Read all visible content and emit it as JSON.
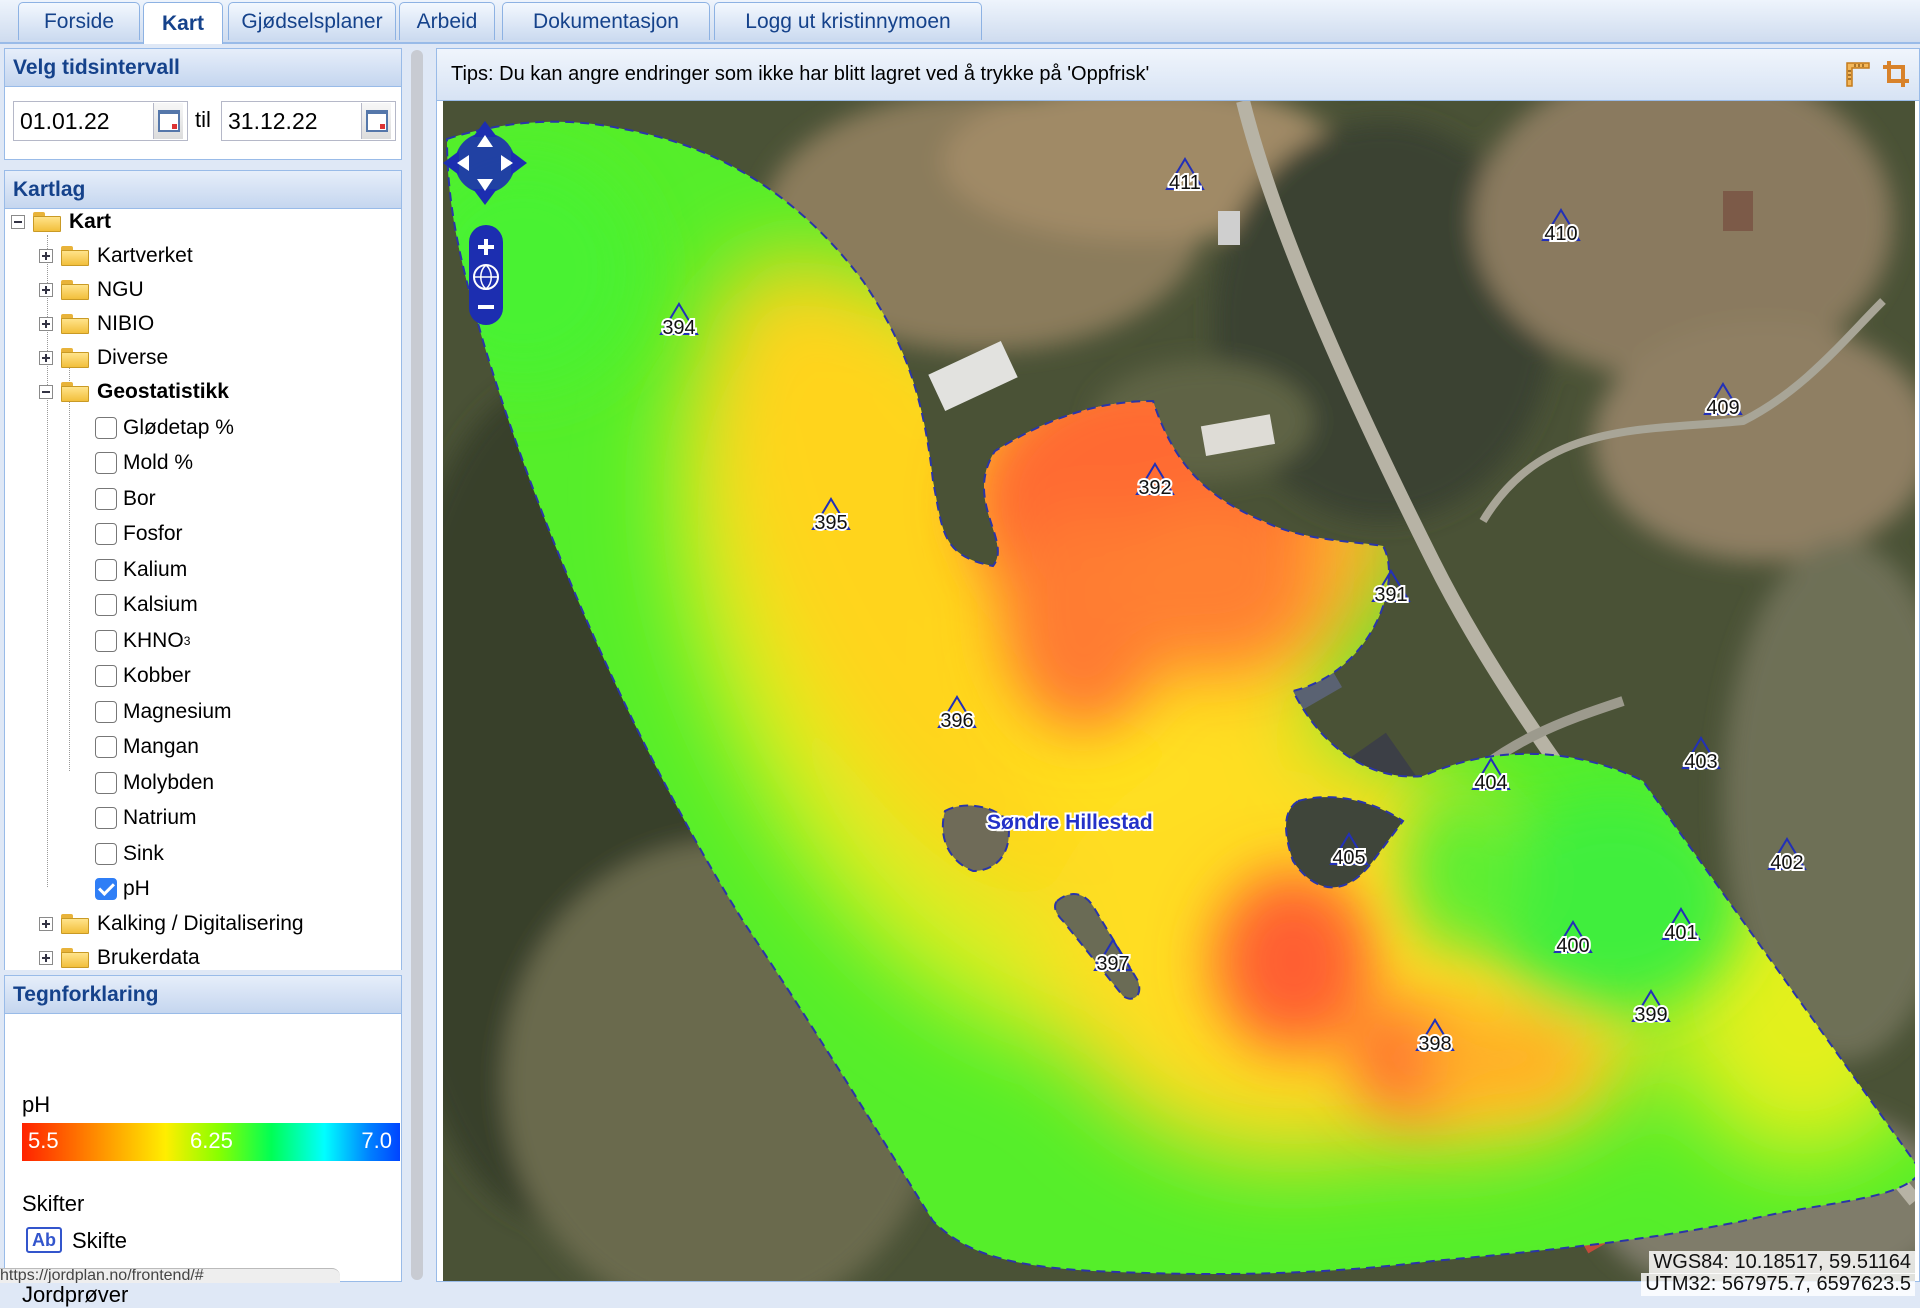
{
  "tabs": [
    {
      "label": "Forside",
      "active": false
    },
    {
      "label": "Kart",
      "active": true
    },
    {
      "label": "Gjødselsplaner",
      "active": false
    },
    {
      "label": "Arbeid",
      "active": false
    },
    {
      "label": "Dokumentasjon",
      "active": false
    },
    {
      "label": "Logg ut kristinnymoen",
      "active": false
    }
  ],
  "time_panel": {
    "title": "Velg tidsintervall",
    "from": "01.01.22",
    "to_label": "til",
    "to": "31.12.22"
  },
  "layers_panel": {
    "title": "Kartlag",
    "root": "Kart",
    "folders": [
      "Kartverket",
      "NGU",
      "NIBIO",
      "Diverse"
    ],
    "geostat_folder": "Geostatistikk",
    "geostat_items": [
      {
        "label": "Glødetap %",
        "checked": false
      },
      {
        "label": "Mold %",
        "checked": false
      },
      {
        "label": "Bor",
        "checked": false
      },
      {
        "label": "Fosfor",
        "checked": false
      },
      {
        "label": "Kalium",
        "checked": false
      },
      {
        "label": "Kalsium",
        "checked": false
      },
      {
        "label": "KHNO",
        "sub": "3",
        "checked": false
      },
      {
        "label": "Kobber",
        "checked": false
      },
      {
        "label": "Magnesium",
        "checked": false
      },
      {
        "label": "Mangan",
        "checked": false
      },
      {
        "label": "Molybden",
        "checked": false
      },
      {
        "label": "Natrium",
        "checked": false
      },
      {
        "label": "Sink",
        "checked": false
      },
      {
        "label": "pH",
        "checked": true
      }
    ],
    "more_folders": [
      "Kalking / Digitalisering",
      "Brukerdata"
    ]
  },
  "legend": {
    "title": "Tegnforklaring",
    "ph_title": "pH",
    "scale": [
      "5.5",
      "6.25",
      "7.0"
    ],
    "skifter_title": "Skifter",
    "skifte_label": "Skifte",
    "jordprover_title": "Jordprøver"
  },
  "map": {
    "tip": "Tips: Du kan angre endringer som ikke har blitt lagret ved å trykke på 'Oppfrisk'",
    "field_name": "Søndre Hillestad",
    "sample_points": [
      "411",
      "410",
      "394",
      "409",
      "392",
      "395",
      "391",
      "403",
      "396",
      "404",
      "405",
      "402",
      "401",
      "400",
      "397",
      "399",
      "398"
    ],
    "coord_wgs": "WGS84: 10.18517, 59.51164",
    "coord_utm": "UTM32: 567975.7, 6597623.5",
    "status_url": "https://jordplan.no/frontend/#"
  }
}
